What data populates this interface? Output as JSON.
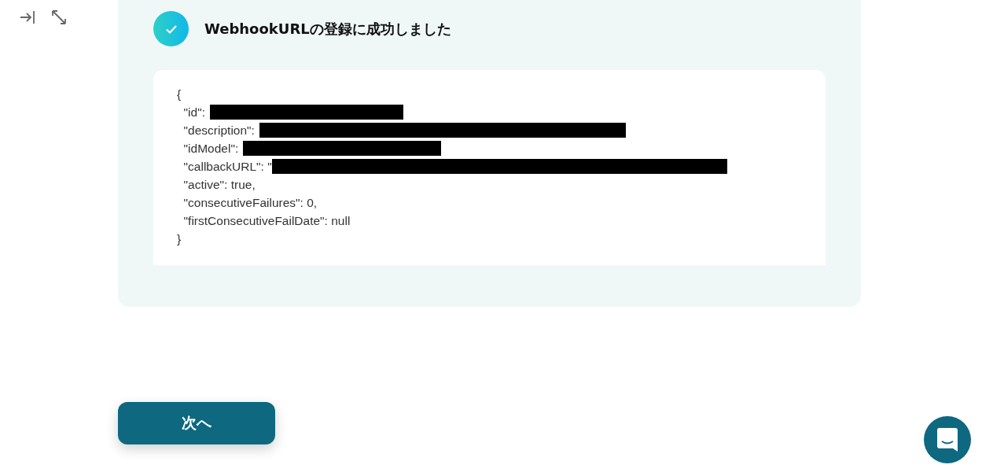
{
  "toolbar": [
    {
      "kind": "collapse"
    },
    {
      "kind": "expand"
    }
  ],
  "result": {
    "title": "WebhookURLの登録に成功しました",
    "code_lines": [
      {
        "text": "{",
        "redacted": false
      },
      {
        "text": "  \"id\":",
        "redacted": true
      },
      {
        "text": "  \"description\":",
        "redacted": true
      },
      {
        "text": "  \"idModel\":",
        "redacted": true
      },
      {
        "text": "  \"callbackURL\": \"",
        "redacted": true
      },
      {
        "text": "  \"active\": true,",
        "redacted": false
      },
      {
        "text": "  \"consecutiveFailures\": 0,",
        "redacted": false
      },
      {
        "text": "  \"firstConsecutiveFailDate\": null",
        "redacted": false
      },
      {
        "text": "}",
        "redacted": false
      }
    ]
  },
  "next_button": {
    "label": "次へ"
  },
  "chat_button": {
    "kind": "chat"
  }
}
